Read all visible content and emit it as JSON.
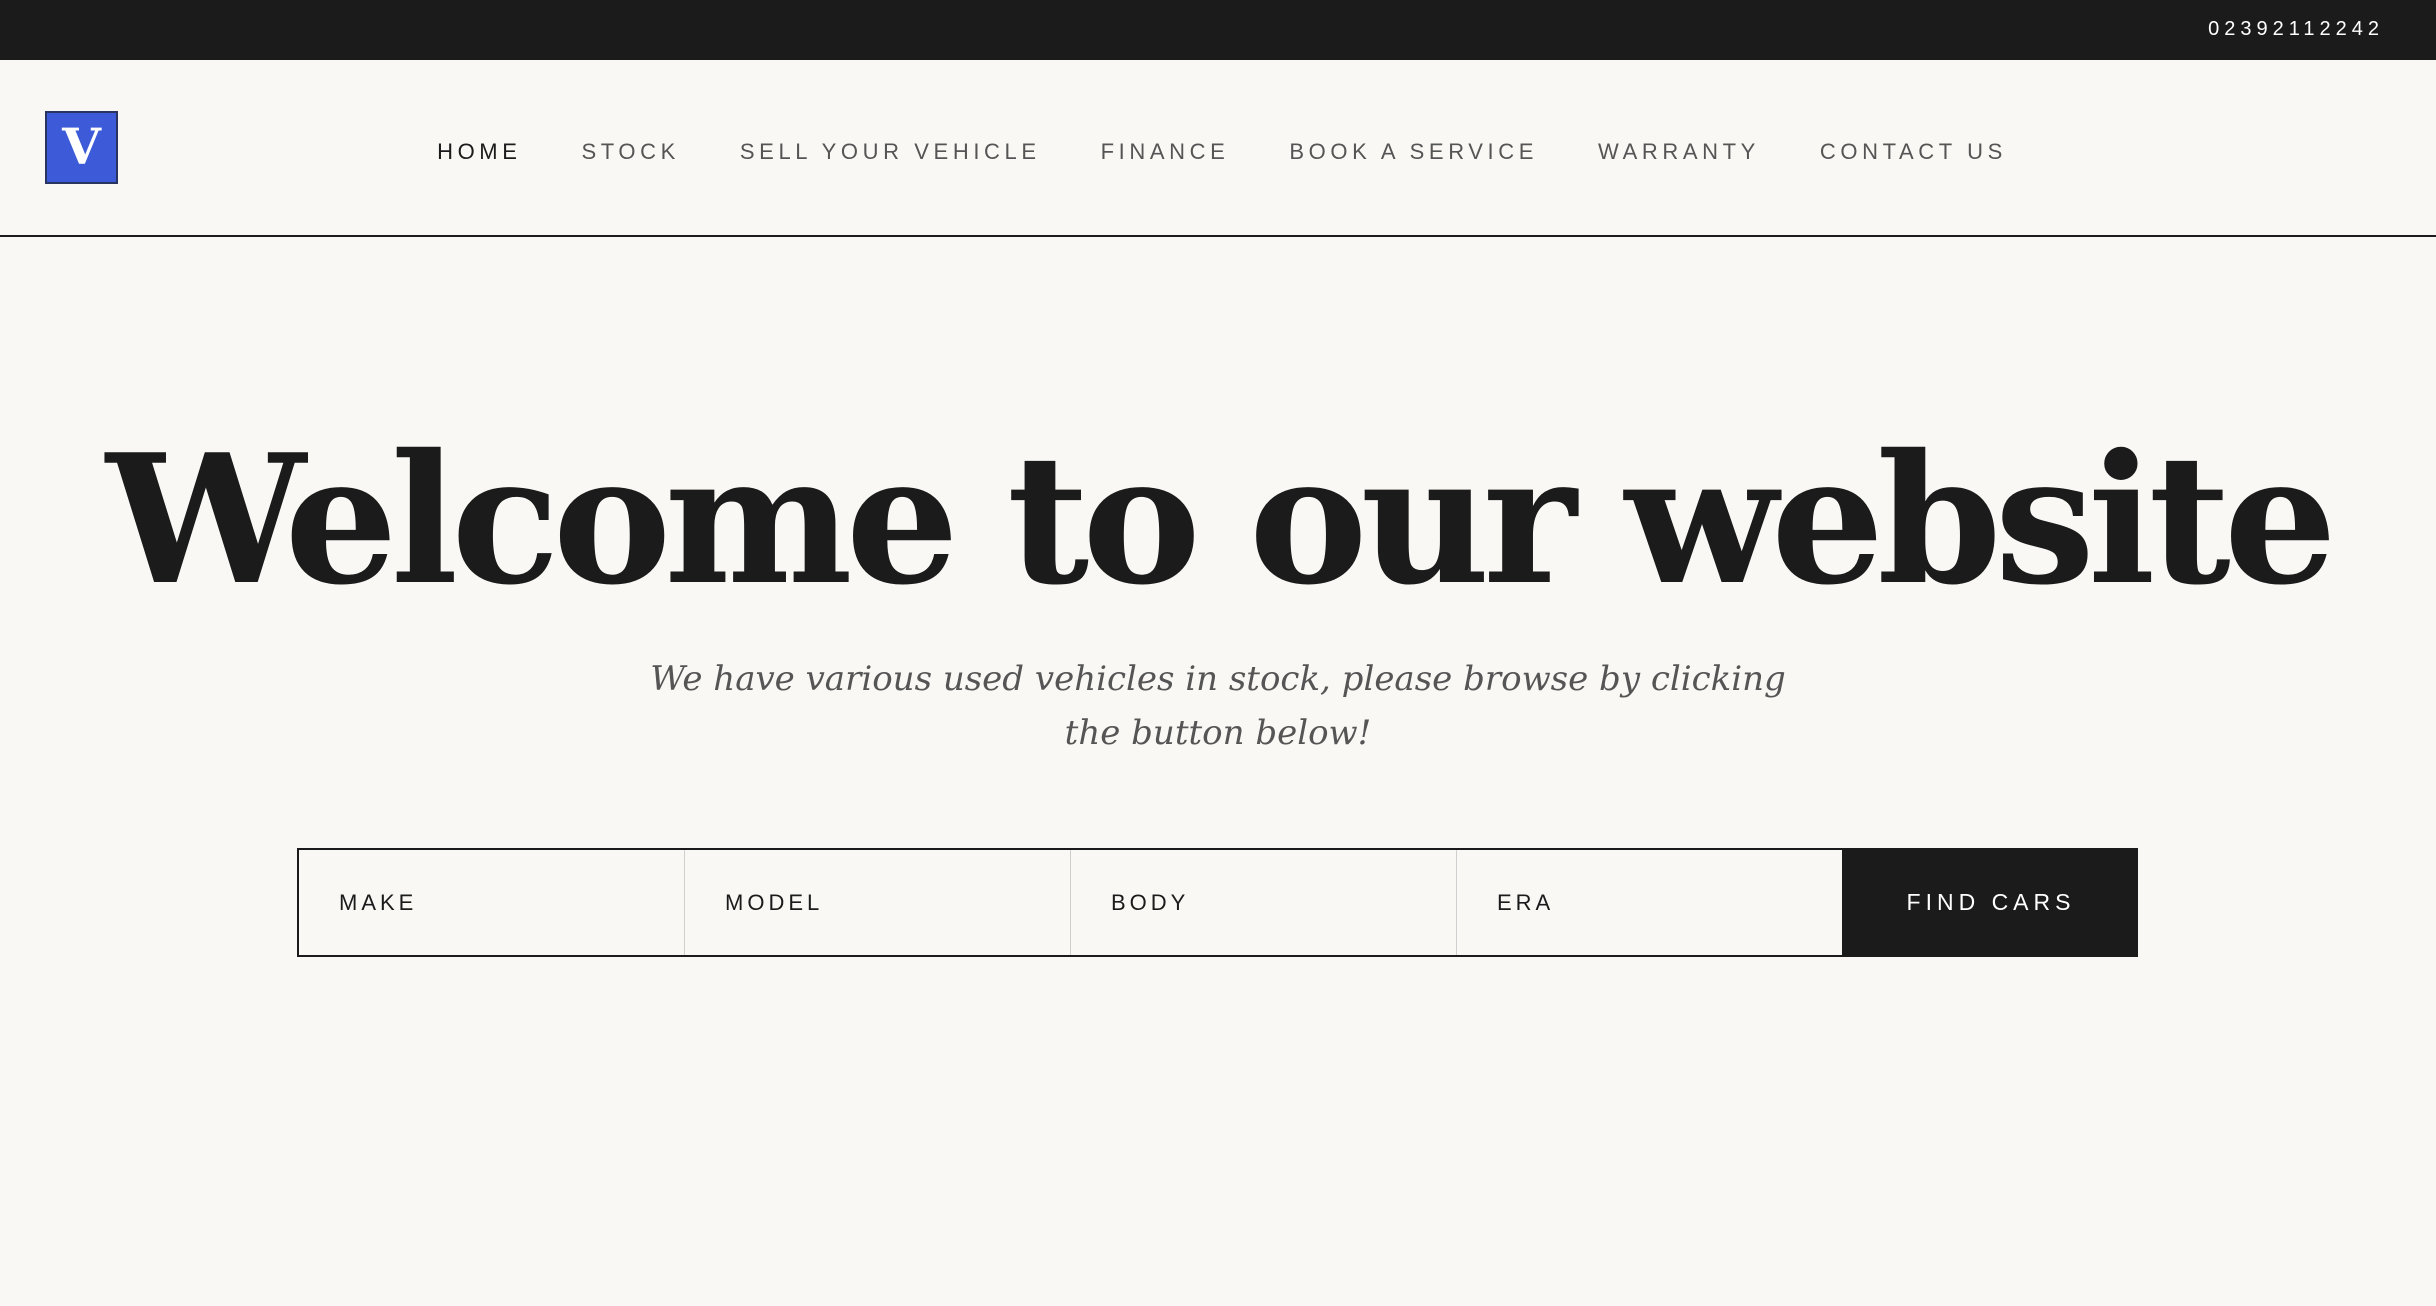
{
  "topbar": {
    "phone": "02392112242"
  },
  "header": {
    "logo_letter": "V",
    "nav": [
      {
        "label": "HOME",
        "active": true
      },
      {
        "label": "STOCK",
        "active": false
      },
      {
        "label": "SELL YOUR VEHICLE",
        "active": false
      },
      {
        "label": "FINANCE",
        "active": false
      },
      {
        "label": "BOOK A SERVICE",
        "active": false
      },
      {
        "label": "WARRANTY",
        "active": false
      },
      {
        "label": "CONTACT US",
        "active": false
      }
    ]
  },
  "hero": {
    "title": "Welcome to our website",
    "subtitle": "We have various used vehicles in stock, please browse by clicking the button below!"
  },
  "search": {
    "filters": [
      {
        "label": "MAKE"
      },
      {
        "label": "MODEL"
      },
      {
        "label": "BODY"
      },
      {
        "label": "ERA"
      }
    ],
    "button_label": "FIND CARS"
  },
  "colors": {
    "background": "#f9f8f4",
    "dark": "#1b1b1b",
    "logo_blue": "#3d5bd8",
    "muted_text": "#555555"
  },
  "icons": {
    "logo": "v-logo-icon"
  }
}
